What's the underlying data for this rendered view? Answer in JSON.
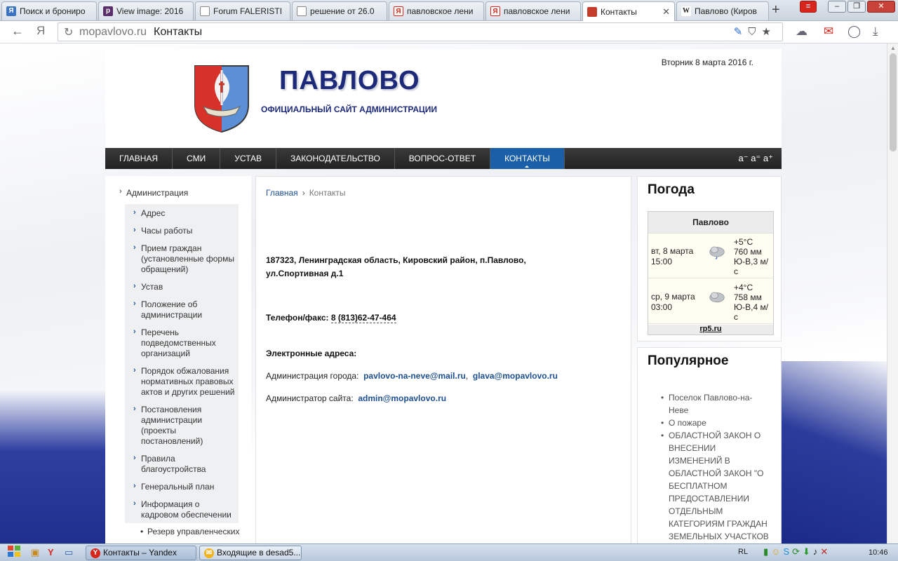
{
  "browser": {
    "tabs": [
      {
        "title": "Поиск и брониро",
        "icon": "yandex-search-icon",
        "color": "#3b74c4"
      },
      {
        "title": "View image: 2016",
        "icon": "p-icon",
        "color": "#5a2d6b"
      },
      {
        "title": "Forum FALERISTI",
        "icon": "page-icon",
        "color": "#888888"
      },
      {
        "title": "решение от 26.0",
        "icon": "page-icon",
        "color": "#888888"
      },
      {
        "title": "павловское лени",
        "icon": "yandex-icon",
        "color": "#d9261c"
      },
      {
        "title": "павловское лени",
        "icon": "yandex-icon",
        "color": "#d9261c"
      },
      {
        "title": "Контакты",
        "icon": "crest-icon",
        "color": "#c43c2a"
      },
      {
        "title": "Павлово (Киров",
        "icon": "wikipedia-icon",
        "color": "#222222"
      }
    ],
    "url_host": "mopavlovo.ru",
    "url_title": "Контакты"
  },
  "site": {
    "title": "ПАВЛОВО",
    "subtitle": "ОФИЦИАЛЬНЫЙ САЙТ АДМИНИСТРАЦИИ",
    "date": "Вторник 8 марта 2016 г.",
    "menu": [
      "ГЛАВНАЯ",
      "СМИ",
      "УСТАВ",
      "ЗАКОНОДАТЕЛЬСТВО",
      "ВОПРОС-ОТВЕТ",
      "КОНТАКТЫ"
    ],
    "font_size_controls": "a⁻ a⁼ a⁺",
    "accent_color": "#1a5fa8"
  },
  "sidebar": {
    "top_item": "Администрация",
    "items": [
      "Адрес",
      "Часы работы",
      "Прием граждан (установленные формы обращений)",
      "Устав",
      "Положение об администрации",
      "Перечень подведомственных организаций",
      "Порядок обжалования нормативных правовых актов и других решений",
      "Постановления администрации (проекты постановлений)",
      "Правила благоустройства",
      "Генеральный план",
      "Информация о кадровом обеспечении"
    ],
    "sub_item": "Резерв управленческих"
  },
  "content": {
    "breadcrumb_home": "Главная",
    "breadcrumb_sep": "›",
    "breadcrumb_current": "Контакты",
    "address": "187323, Ленинградская область, Кировский район, п.Павлово, ул.Спортивная д.1",
    "phone_label": "Телефон/факс:",
    "phone_value": "8 (813)62-47-464",
    "emails_heading": "Электронные адреса:",
    "admin_city_label": "Администрация города:",
    "admin_city_email1": "pavlovo-na-neve@mail.ru",
    "admin_city_email2": "glava@mopavlovo.ru",
    "site_admin_label": "Администратор сайта:",
    "site_admin_email": "admin@mopavlovo.ru"
  },
  "weather": {
    "heading": "Погода",
    "city": "Павлово",
    "rows": [
      {
        "day": "вт, 8 марта",
        "time": "15:00",
        "temp": "+5°C",
        "pressure": "760 мм",
        "wind": "Ю-В,3 м/с"
      },
      {
        "day": "ср, 9 марта",
        "time": "03:00",
        "temp": "+4°C",
        "pressure": "758 мм",
        "wind": "Ю-В,4 м/с"
      }
    ],
    "source": "rp5.ru"
  },
  "popular": {
    "heading": "Популярное",
    "items": [
      "Поселок Павлово-на-Неве",
      "О пожаре",
      "ОБЛАСТНОЙ ЗАКОН О ВНЕСЕНИИ ИЗМЕНЕНИЙ В ОБЛАСТНОЙ ЗАКОН \"О БЕСПЛАТНОМ ПРЕДОСТАВЛЕНИИ ОТДЕЛЬНЫМ КАТЕГОРИЯМ ГРАЖДАН ЗЕМЕЛЬНЫХ УЧАСТКОВ"
    ]
  },
  "taskbar": {
    "tasks": [
      {
        "label": "Контакты – Yandex",
        "icon": "yandex-browser-icon"
      },
      {
        "label": "Входящие в desad5...",
        "icon": "mail-icon"
      }
    ],
    "language": "RL",
    "clock": "10:46"
  }
}
